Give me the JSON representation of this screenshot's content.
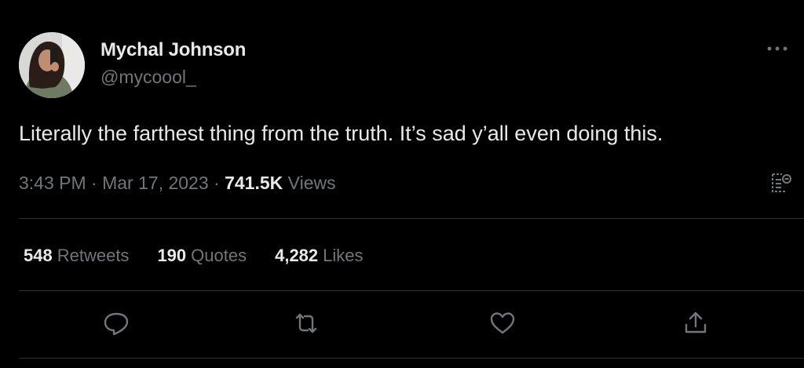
{
  "author": {
    "name": "Mychal Johnson",
    "handle": "@mycoool_"
  },
  "tweet": {
    "text": "Literally the farthest thing from the truth. It’s sad y’all even doing this.",
    "time": "3:43 PM",
    "separator_1": " · ",
    "date": "Mar 17, 2023",
    "separator_2": " · ",
    "views_count": "741.5K",
    "views_label": " Views"
  },
  "stats": {
    "retweets": {
      "count": "548",
      "label": "Retweets"
    },
    "quotes": {
      "count": "190",
      "label": "Quotes"
    },
    "likes": {
      "count": "4,282",
      "label": "Likes"
    }
  },
  "icons": {
    "more": "more-horizontal-icon",
    "analytics": "analytics-icon",
    "reply": "reply-icon",
    "retweet": "retweet-icon",
    "like": "like-icon",
    "share": "share-icon"
  },
  "colors": {
    "background": "#000000",
    "primary_text": "#e7e9ea",
    "secondary_text": "#71767b",
    "divider": "#2f3336"
  }
}
